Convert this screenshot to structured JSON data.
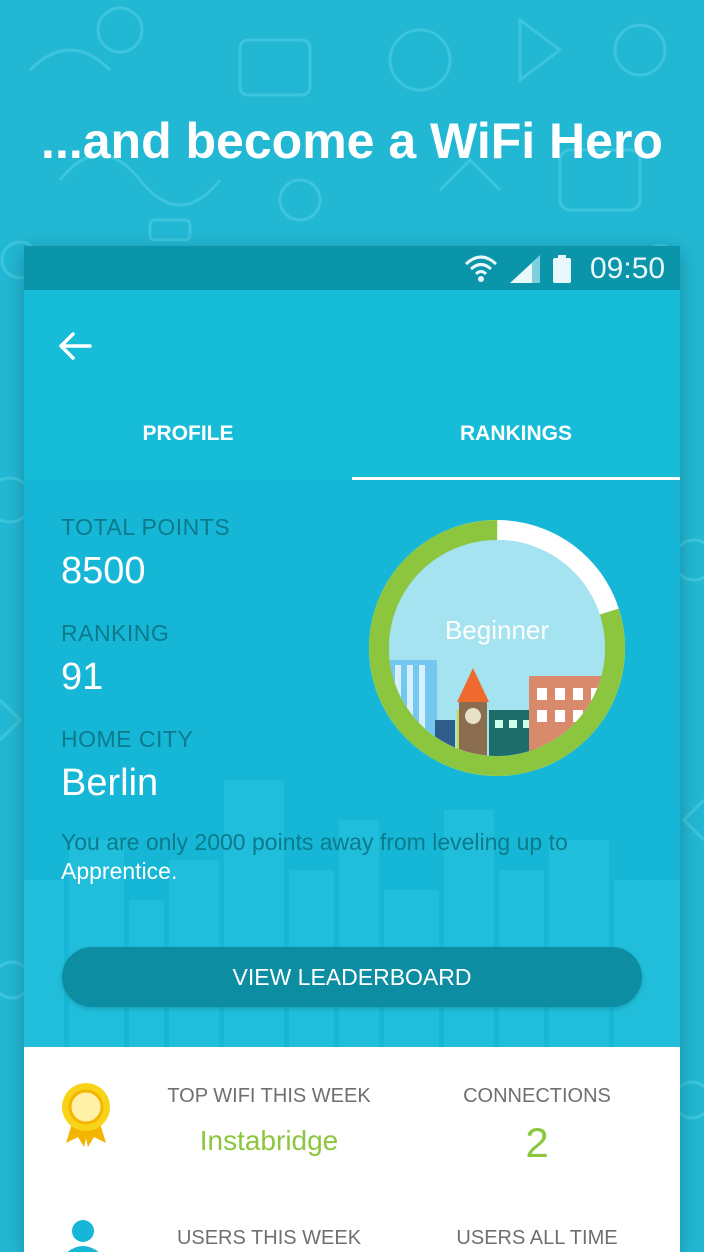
{
  "headline": "...and become a WiFi Hero",
  "status_bar": {
    "time": "09:50"
  },
  "tabs": {
    "profile": "PROFILE",
    "rankings": "RANKINGS",
    "active": "rankings"
  },
  "stats": {
    "total_points_label": "TOTAL POINTS",
    "total_points": "8500",
    "ranking_label": "RANKING",
    "ranking": "91",
    "home_city_label": "HOME CITY",
    "home_city": "Berlin"
  },
  "level": {
    "name": "Beginner",
    "progress_fraction": 0.8
  },
  "info": {
    "prefix": "You are only ",
    "points": "2000",
    "middle": " points away from leveling up to ",
    "next_level": "Apprentice."
  },
  "leaderboard_button": "VIEW LEADERBOARD",
  "weekly": {
    "top_wifi_label": "TOP WIFI THIS WEEK",
    "top_wifi": "Instabridge",
    "connections_label": "CONNECTIONS",
    "connections": "2",
    "users_week_label": "USERS THIS WEEK",
    "users_all_label": "USERS ALL TIME"
  },
  "colors": {
    "background": "#22b8d4",
    "accent_green": "#8cc63f",
    "button": "#0d8da2",
    "status_bar": "#0a95aa"
  },
  "icons": [
    "back-arrow-icon",
    "wifi-icon",
    "signal-icon",
    "battery-icon",
    "medal-icon",
    "user-icon"
  ]
}
